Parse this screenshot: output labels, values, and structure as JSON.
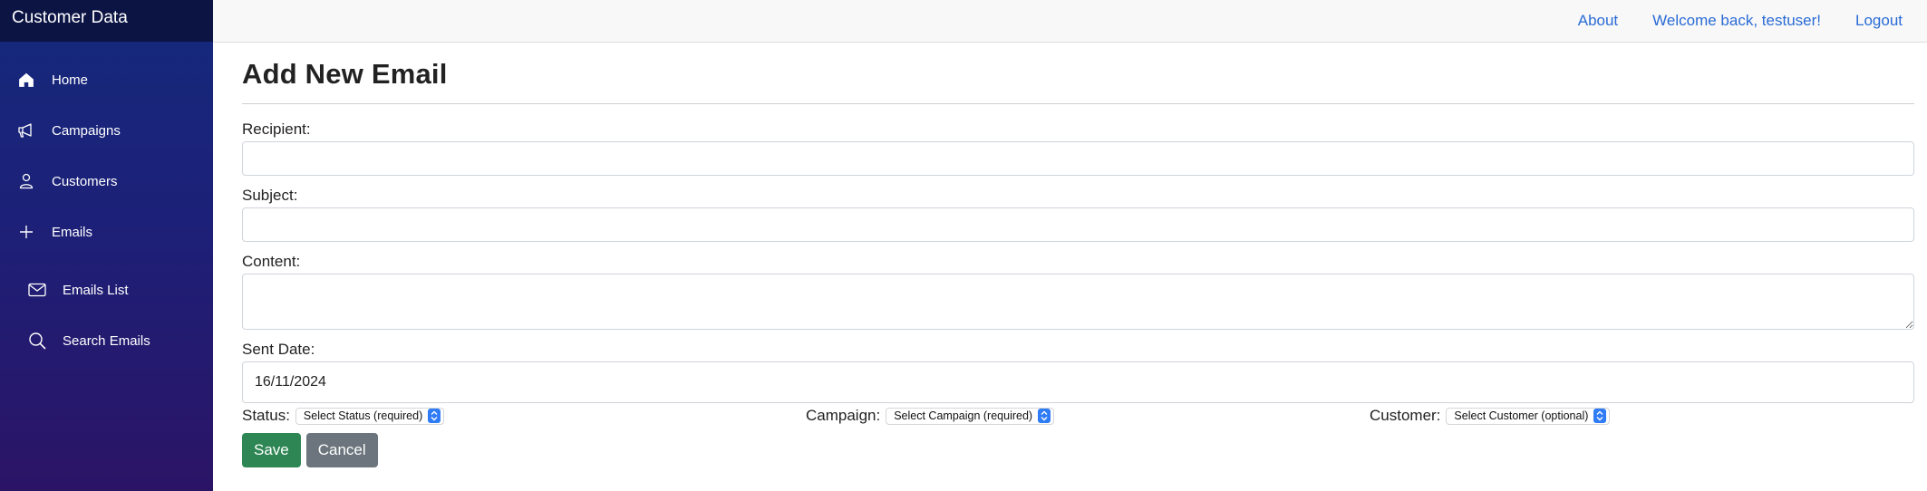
{
  "sidebar": {
    "brand": "Customer Data",
    "items": [
      {
        "label": "Home",
        "icon": "home-icon"
      },
      {
        "label": "Campaigns",
        "icon": "megaphone-icon"
      },
      {
        "label": "Customers",
        "icon": "person-icon"
      },
      {
        "label": "Emails",
        "icon": "plus-icon"
      }
    ],
    "subitems": [
      {
        "label": "Emails List",
        "icon": "envelope-icon"
      },
      {
        "label": "Search Emails",
        "icon": "search-icon"
      }
    ]
  },
  "topbar": {
    "about": "About",
    "welcome": "Welcome back, testuser!",
    "logout": "Logout"
  },
  "form": {
    "title": "Add New Email",
    "recipient_label": "Recipient:",
    "recipient_value": "",
    "subject_label": "Subject:",
    "subject_value": "",
    "content_label": "Content:",
    "content_value": "",
    "sent_date_label": "Sent Date:",
    "sent_date_value": "16/11/2024",
    "status_label": "Status:",
    "status_value": "Select Status (required)",
    "campaign_label": "Campaign:",
    "campaign_value": "Select Campaign (required)",
    "customer_label": "Customer:",
    "customer_value": "Select Customer (optional)",
    "save_label": "Save",
    "cancel_label": "Cancel"
  },
  "colors": {
    "sidebar_top": "#142a7c",
    "sidebar_bottom": "#2b1466",
    "brand_bg": "#0c1444",
    "link": "#2a6bd6",
    "save": "#2d8653",
    "cancel": "#6c757d",
    "select_arrow": "#2f7cf6"
  }
}
